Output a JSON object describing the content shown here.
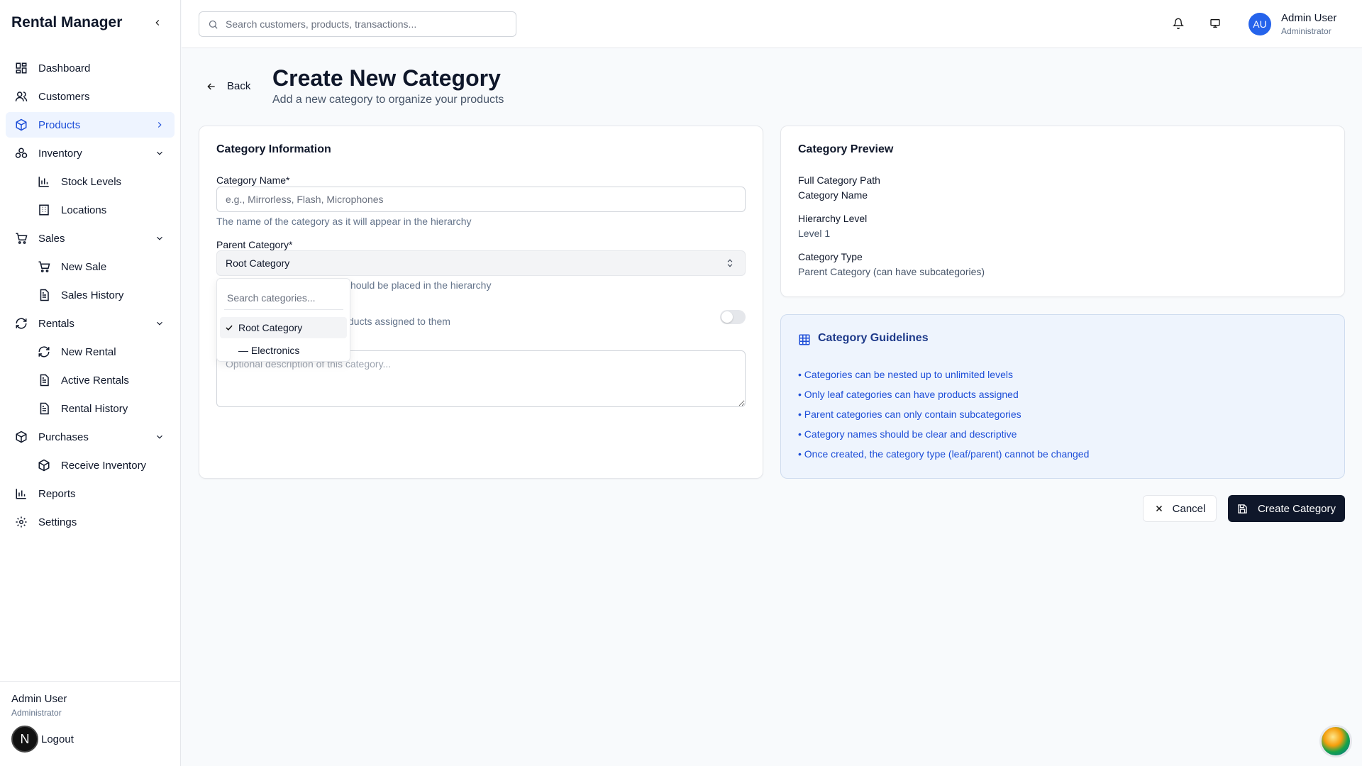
{
  "app": {
    "title": "Rental Manager"
  },
  "sidebar": {
    "items": [
      {
        "label": "Dashboard",
        "icon": "dashboard-icon"
      },
      {
        "label": "Customers",
        "icon": "users-icon"
      },
      {
        "label": "Products",
        "icon": "package-icon",
        "active": true
      },
      {
        "label": "Inventory",
        "icon": "boxes-icon"
      },
      {
        "label": "Stock Levels",
        "icon": "bar-chart-icon"
      },
      {
        "label": "Locations",
        "icon": "building-icon"
      },
      {
        "label": "Sales",
        "icon": "cart-icon"
      },
      {
        "label": "New Sale",
        "icon": "cart-icon"
      },
      {
        "label": "Sales History",
        "icon": "file-icon"
      },
      {
        "label": "Rentals",
        "icon": "refresh-icon"
      },
      {
        "label": "New Rental",
        "icon": "refresh-icon"
      },
      {
        "label": "Active Rentals",
        "icon": "file-icon"
      },
      {
        "label": "Rental History",
        "icon": "file-icon"
      },
      {
        "label": "Purchases",
        "icon": "package-icon"
      },
      {
        "label": "Receive Inventory",
        "icon": "package-icon"
      },
      {
        "label": "Reports",
        "icon": "bar-chart-icon"
      },
      {
        "label": "Settings",
        "icon": "gear-icon"
      }
    ],
    "footer": {
      "name": "Admin User",
      "role": "Administrator",
      "logout": "Logout",
      "badge": "N"
    }
  },
  "topbar": {
    "search_placeholder": "Search customers, products, transactions...",
    "user": {
      "initials": "AU",
      "name": "Admin User",
      "role": "Administrator"
    }
  },
  "header": {
    "back_label": "Back",
    "title": "Create New Category",
    "subtitle": "Add a new category to organize your products"
  },
  "form": {
    "title": "Category Information",
    "name_label": "Category Name*",
    "name_placeholder": "e.g., Mirrorless, Flash, Microphones",
    "name_hint": "The name of the category as it will appear in the hierarchy",
    "parent_label": "Parent Category*",
    "parent_value": "Root Category",
    "parent_hint_partial": "hould be placed in the hierarchy",
    "leaf_hint_partial": "ducts assigned to them",
    "description_placeholder": "Optional description of this category..."
  },
  "dropdown": {
    "search_placeholder": "Search categories...",
    "options": [
      {
        "label": "Root Category",
        "selected": true
      },
      {
        "label": "— Electronics",
        "selected": false
      }
    ]
  },
  "preview": {
    "title": "Category Preview",
    "path_label": "Full Category Path",
    "path_value": "Category Name",
    "level_label": "Hierarchy Level",
    "level_value": "Level 1",
    "type_label": "Category Type",
    "type_value": "Parent Category (can have subcategories)"
  },
  "guidelines": {
    "title": "Category Guidelines",
    "items": [
      "• Categories can be nested up to unlimited levels",
      "• Only leaf categories can have products assigned",
      "• Parent categories can only contain subcategories",
      "• Category names should be clear and descriptive",
      "• Once created, the category type (leaf/parent) cannot be changed"
    ]
  },
  "actions": {
    "cancel": "Cancel",
    "create": "Create Category"
  },
  "colors": {
    "accent": "#1d4ed8",
    "active_bg": "#eef4ff",
    "primary_button": "#0f172a",
    "guide_bg": "#eef4fd"
  }
}
